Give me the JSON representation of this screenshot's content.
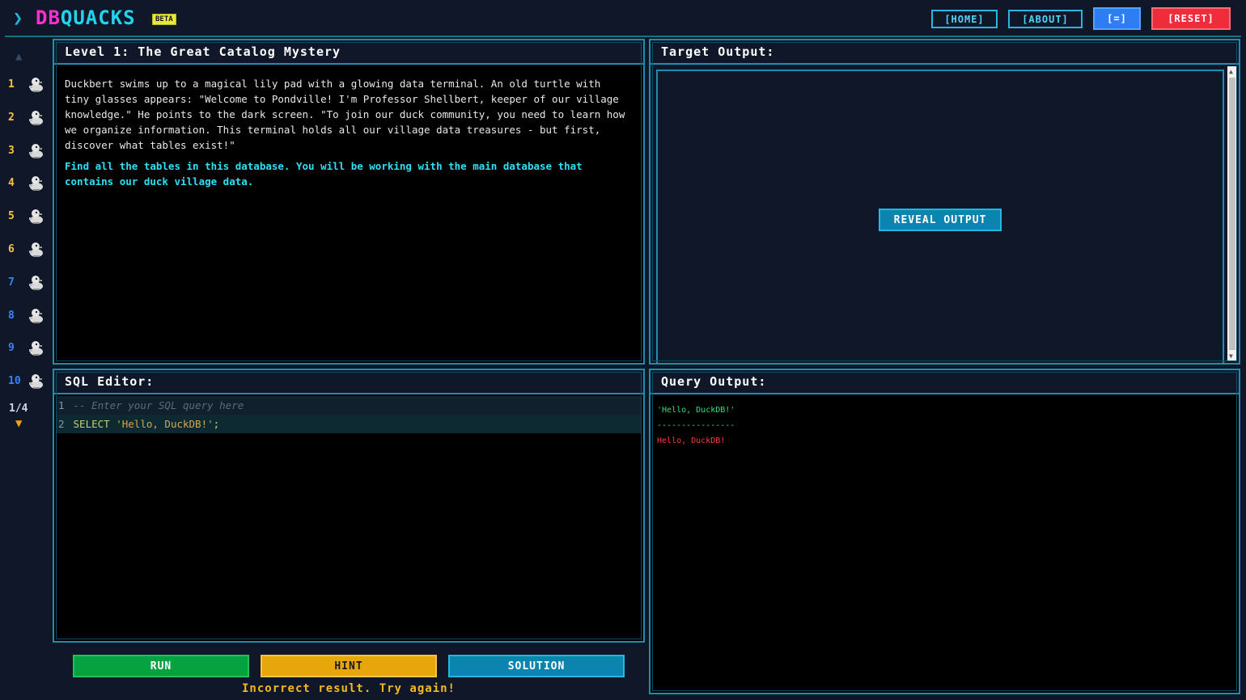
{
  "header": {
    "chevron": "❯",
    "logo_db": "DB",
    "logo_quacks": "QUACKS",
    "beta": "BETA",
    "home": "[HOME]",
    "about": "[ABOUT]",
    "menu": "[=]",
    "reset": "[RESET]"
  },
  "sidebar": {
    "up": "▲",
    "down": "▼",
    "page": "1/4",
    "levels": [
      {
        "num": "1",
        "color": "#f5c542"
      },
      {
        "num": "2",
        "color": "#f5c542"
      },
      {
        "num": "3",
        "color": "#f5c542"
      },
      {
        "num": "4",
        "color": "#f5c542"
      },
      {
        "num": "5",
        "color": "#f5c542"
      },
      {
        "num": "6",
        "color": "#f5c542"
      },
      {
        "num": "7",
        "color": "#3b82f6"
      },
      {
        "num": "8",
        "color": "#3b82f6"
      },
      {
        "num": "9",
        "color": "#3b82f6"
      },
      {
        "num": "10",
        "color": "#3b82f6"
      }
    ]
  },
  "level": {
    "title": "Level 1: The Great Catalog Mystery",
    "story": "Duckbert swims up to a magical lily pad with a glowing data terminal. An old turtle with tiny glasses appears: \"Welcome to Pondville! I'm Professor Shellbert, keeper of our village knowledge.\" He points to the dark screen. \"To join our duck community, you need to learn how we organize information. This terminal holds all our village data treasures - but first, discover what tables exist!\"",
    "task": "Find all the tables in this database. You will be working with the main database that contains our duck village data."
  },
  "target": {
    "title": "Target Output:",
    "reveal": "REVEAL OUTPUT"
  },
  "editor": {
    "title": "SQL Editor:",
    "line1_num": "1",
    "line1": "-- Enter your SQL query here",
    "line2_num": "2",
    "line2_kw": "SELECT",
    "line2_str": "'Hello, DuckDB!'",
    "line2_end": ";"
  },
  "query_output": {
    "title": "Query Output:",
    "header": "'Hello, DuckDB!'",
    "separator": "----------------",
    "value": "Hello, DuckDB!"
  },
  "actions": {
    "run": "RUN",
    "hint": "HINT",
    "solution": "SOLUTION",
    "result": "Incorrect result. Try again!"
  }
}
